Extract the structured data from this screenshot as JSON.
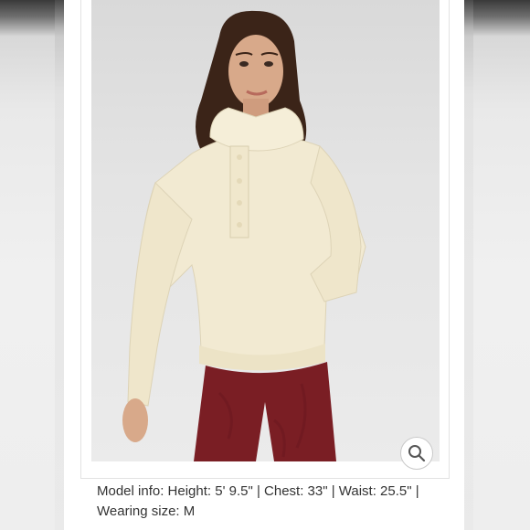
{
  "product_image": {
    "description_alt": "Model wearing cream snap-placket pullover",
    "zoom_icon": "magnifier-icon"
  },
  "caption": {
    "line1": "Model info: Height: 5' 9.5\" | Chest: 33\" | Waist: 25.5\" |",
    "line2": "Wearing size: M"
  },
  "colors": {
    "sweater": "#f2ead2",
    "leggings": "#7a1e24",
    "background": "#e6e6e6",
    "text": "#333333"
  }
}
